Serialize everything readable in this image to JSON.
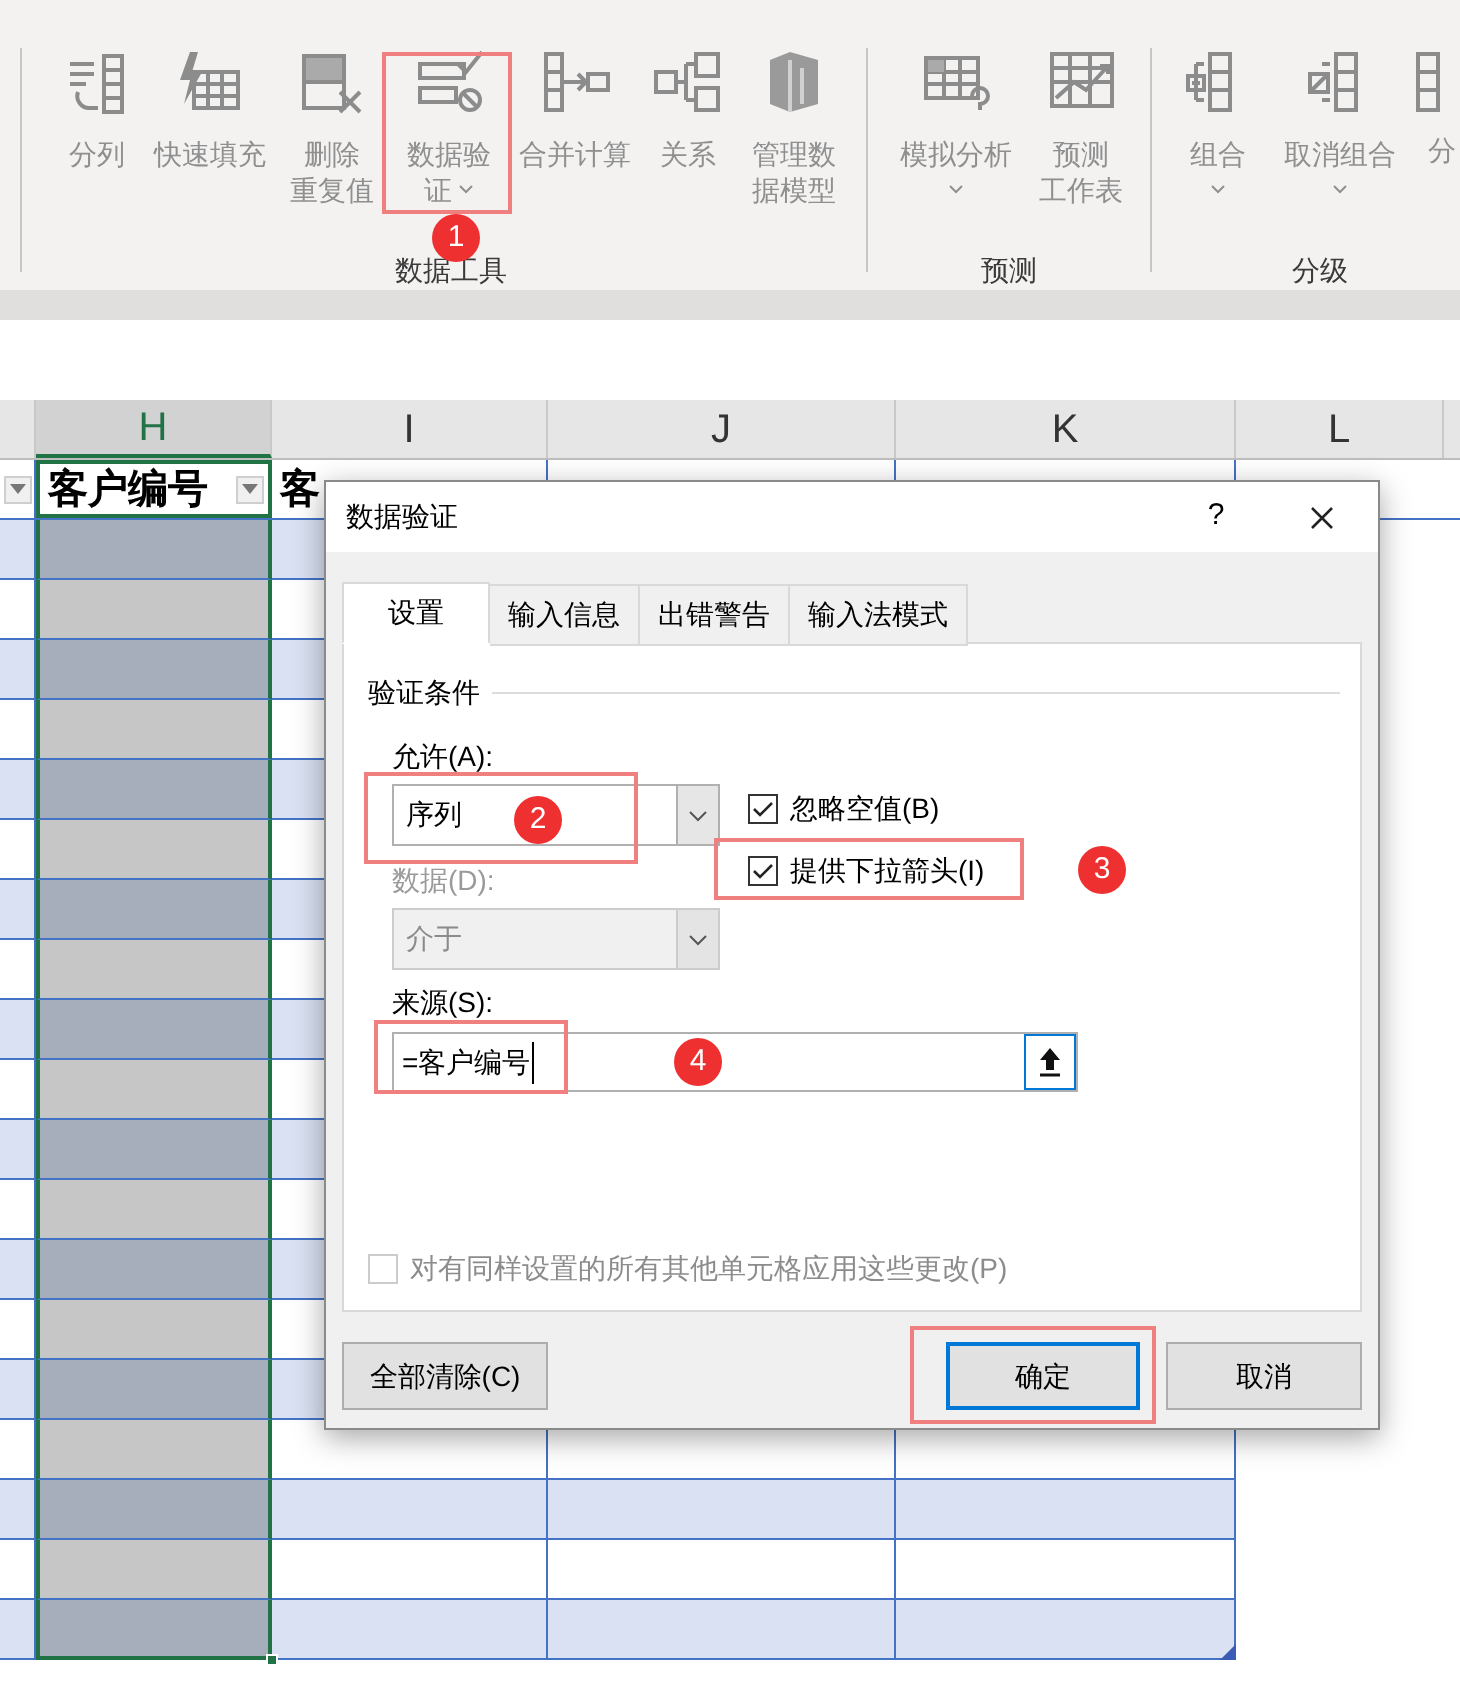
{
  "ribbon": {
    "groups": [
      {
        "label": "数据工具",
        "items": [
          {
            "lines": [
              "分列"
            ],
            "dropdown": false
          },
          {
            "lines": [
              "快速填充"
            ],
            "dropdown": false
          },
          {
            "lines": [
              "删除",
              "重复值"
            ],
            "dropdown": false
          },
          {
            "lines": [
              "数据验",
              "证"
            ],
            "dropdown": true,
            "highlighted": true,
            "badge": "1"
          },
          {
            "lines": [
              "合并计算"
            ],
            "dropdown": false
          },
          {
            "lines": [
              "关系"
            ],
            "dropdown": false
          },
          {
            "lines": [
              "管理数",
              "据模型"
            ],
            "dropdown": false
          }
        ]
      },
      {
        "label": "预测",
        "items": [
          {
            "lines": [
              "模拟分析"
            ],
            "dropdown": true
          },
          {
            "lines": [
              "预测",
              "工作表"
            ],
            "dropdown": false
          }
        ]
      },
      {
        "label": "分级",
        "items": [
          {
            "lines": [
              "组合"
            ],
            "dropdown": true
          },
          {
            "lines": [
              "取消组合"
            ],
            "dropdown": true
          },
          {
            "lines": [
              "分"
            ],
            "dropdown": false
          }
        ]
      }
    ]
  },
  "sheet": {
    "columns": [
      {
        "label": "H",
        "selected": true
      },
      {
        "label": "I",
        "selected": false
      },
      {
        "label": "J",
        "selected": false
      },
      {
        "label": "K",
        "selected": false
      },
      {
        "label": "L",
        "selected": false
      }
    ],
    "header_row": [
      "客户编号",
      "客"
    ]
  },
  "dialog": {
    "title": "数据验证",
    "help_button": "?",
    "tabs": [
      {
        "label": "设置",
        "selected": true
      },
      {
        "label": "输入信息",
        "selected": false
      },
      {
        "label": "出错警告",
        "selected": false
      },
      {
        "label": "输入法模式",
        "selected": false
      }
    ],
    "section_title": "验证条件",
    "allow": {
      "label": "允许(A):",
      "value": "序列",
      "highlighted": true,
      "badge": "2"
    },
    "data": {
      "label": "数据(D):",
      "value": "介于",
      "disabled": true
    },
    "checkboxes": [
      {
        "label": "忽略空值(B)",
        "checked": true,
        "highlighted": false
      },
      {
        "label": "提供下拉箭头(I)",
        "checked": true,
        "highlighted": true,
        "badge": "3"
      }
    ],
    "source": {
      "label": "来源(S):",
      "value": "=客户编号",
      "highlighted": true,
      "badge": "4"
    },
    "apply_all": {
      "label": "对有同样设置的所有其他单元格应用这些更改(P)",
      "checked": false,
      "disabled": true
    },
    "buttons": [
      {
        "label": "全部清除(C)",
        "default": false,
        "highlighted": false
      },
      {
        "label": "确定",
        "default": true,
        "highlighted": true
      },
      {
        "label": "取消",
        "default": false,
        "highlighted": false
      }
    ]
  }
}
